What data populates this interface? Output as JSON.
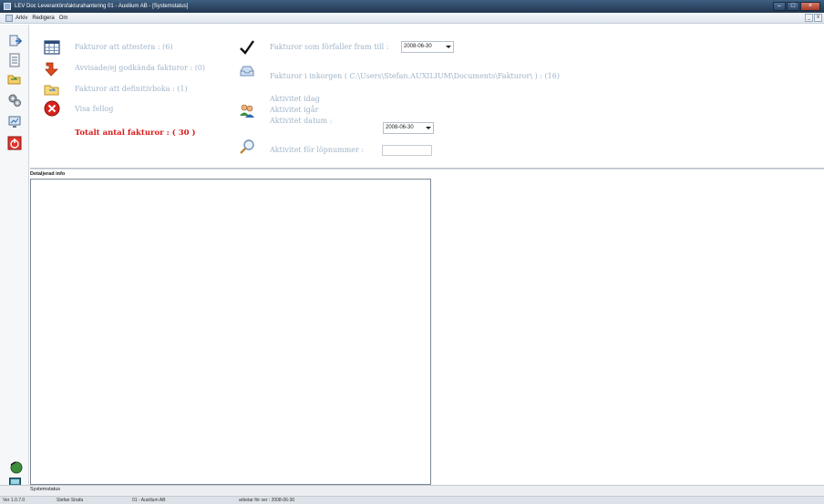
{
  "window": {
    "title": "LEV Doc  Leverantörsfakturahantering  01 - Auxilium AB - [Systemstatus]"
  },
  "menu": {
    "items": [
      "Arkiv",
      "Redigera",
      "Om"
    ]
  },
  "dashboard": {
    "left": [
      {
        "label": "Fakturor att attestera : (6)",
        "icon": "calendar-grid-icon"
      },
      {
        "label": "Avvisade/ej godkända fakturor : (0)",
        "icon": "red-arrow-icon"
      },
      {
        "label": "Fakturor att definitivboka : (1)",
        "icon": "folder-arrow-icon"
      },
      {
        "label": "Visa fellog",
        "icon": "error-x-icon"
      }
    ],
    "total_label": "Totalt antal fakturor : ( 30 )",
    "right": {
      "due_label": "Fakturor som förfaller fram till :",
      "due_date": "2008-06-30",
      "inbox_label": "Fakturor i inkorgen ( C:\\Users\\Stefan.AUXILIUM\\Documents\\Fakturor\\ ) : (16)",
      "activity_today": "Aktivitet idag",
      "activity_yesterday": "Aktivitet igår",
      "activity_date_label": "Aktivitet datum :",
      "activity_date": "2008-06-30",
      "activity_serial_label": "Aktivitet för löpnummer :",
      "activity_serial_value": ""
    }
  },
  "detail": {
    "header": "Detaljerad info"
  },
  "tabs": {
    "active": "Systemstatus"
  },
  "statusbar": {
    "version": "Ver 1.0.7.0",
    "user": "Stefan Strafa",
    "company": "01 - Auxilium AB",
    "date": "arbetar för ver : 2008-06-30"
  },
  "colors": {
    "label": "#9fb4c9",
    "total": "#d91a1a",
    "titlebar": "#2e4763"
  }
}
